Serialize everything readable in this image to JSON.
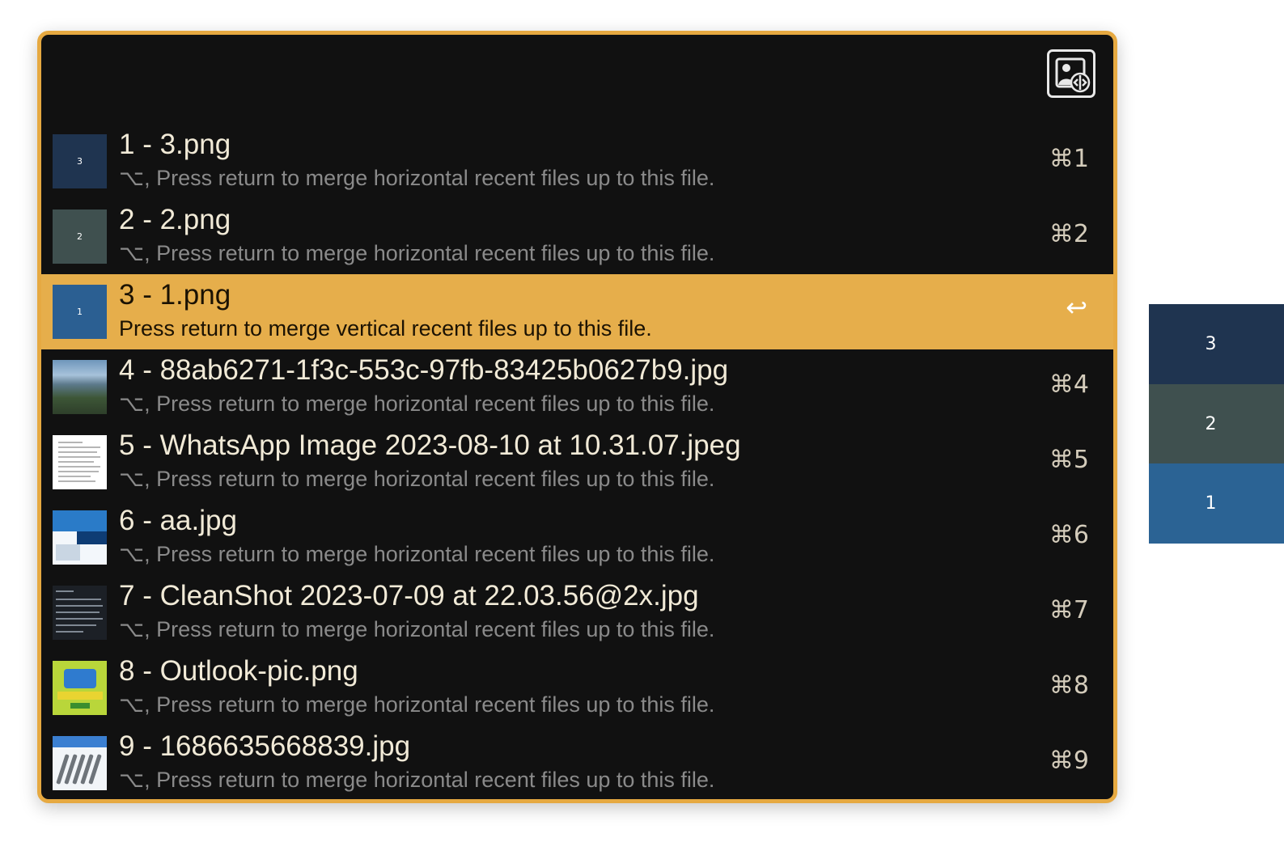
{
  "query": {
    "value": "",
    "placeholder": ""
  },
  "workflow": {
    "icon": "image-merge-icon"
  },
  "results": [
    {
      "title": "1 - 3.png",
      "subtitle": "⌥, Press return to merge horizontal recent files up to this file.",
      "shortcut": "⌘1",
      "thumb_label": "3",
      "selected": false
    },
    {
      "title": "2 - 2.png",
      "subtitle": "⌥, Press return to merge horizontal recent files up to this file.",
      "shortcut": "⌘2",
      "thumb_label": "2",
      "selected": false
    },
    {
      "title": "3 - 1.png",
      "subtitle": "Press return to merge vertical recent files up to this file.",
      "shortcut": "↩",
      "thumb_label": "1",
      "selected": true
    },
    {
      "title": "4 - 88ab6271-1f3c-553c-97fb-83425b0627b9.jpg",
      "subtitle": "⌥, Press return to merge horizontal recent files up to this file.",
      "shortcut": "⌘4",
      "thumb_label": "",
      "selected": false
    },
    {
      "title": "5 - WhatsApp Image 2023-08-10 at 10.31.07.jpeg",
      "subtitle": "⌥, Press return to merge horizontal recent files up to this file.",
      "shortcut": "⌘5",
      "thumb_label": "",
      "selected": false
    },
    {
      "title": "6 - aa.jpg",
      "subtitle": "⌥, Press return to merge horizontal recent files up to this file.",
      "shortcut": "⌘6",
      "thumb_label": "",
      "selected": false
    },
    {
      "title": "7 - CleanShot 2023-07-09 at 22.03.56@2x.jpg",
      "subtitle": "⌥, Press return to merge horizontal recent files up to this file.",
      "shortcut": "⌘7",
      "thumb_label": "",
      "selected": false
    },
    {
      "title": "8 - Outlook-pic.png",
      "subtitle": "⌥, Press return to merge horizontal recent files up to this file.",
      "shortcut": "⌘8",
      "thumb_label": "",
      "selected": false
    },
    {
      "title": "9 - 1686635668839.jpg",
      "subtitle": "⌥, Press return to merge horizontal recent files up to this file.",
      "shortcut": "⌘9",
      "thumb_label": "",
      "selected": false
    }
  ],
  "preview_strip": [
    {
      "label": "3",
      "color": "#1f3450"
    },
    {
      "label": "2",
      "color": "#3f504f"
    },
    {
      "label": "1",
      "color": "#2b6394"
    }
  ],
  "colors": {
    "accent": "#e6a941",
    "selected_row": "#e6ae4b",
    "window_bg": "#111111",
    "title_text": "#f1ead7",
    "subtitle_text": "#8a8a8a"
  }
}
